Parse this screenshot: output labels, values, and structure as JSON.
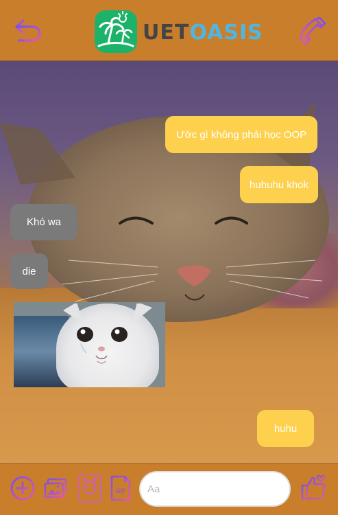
{
  "header": {
    "app_name_part1": "UET",
    "app_name_part2": "OASIS",
    "back_icon": "back-arrow-icon",
    "call_icon": "phone-icon"
  },
  "messages": [
    {
      "direction": "out",
      "text": "Ước gì không phải học OOP"
    },
    {
      "direction": "out",
      "text": "huhuhu khok"
    },
    {
      "direction": "in",
      "text": "Khó wa"
    },
    {
      "direction": "in",
      "text": "die"
    },
    {
      "direction": "in",
      "type": "image",
      "image": "crying-cat-sticker"
    },
    {
      "direction": "out",
      "text": "huhu"
    }
  ],
  "composer": {
    "placeholder": "Aa",
    "value": "",
    "tools": [
      "add-icon",
      "image-gallery-icon",
      "sticker-icon",
      "gif-icon"
    ],
    "like_icon": "thumbs-up-heart-icon",
    "gif_label": "GIF"
  },
  "colors": {
    "header_bg": "#c97e2c",
    "outgoing_bubble": "#fdd14d",
    "incoming_bubble": "#7a7a7a",
    "icon_gradient_start": "#7b4ff0",
    "icon_gradient_end": "#e05aa8",
    "logo_green": "#1db26a",
    "logo_blue": "#4fb6e3"
  }
}
